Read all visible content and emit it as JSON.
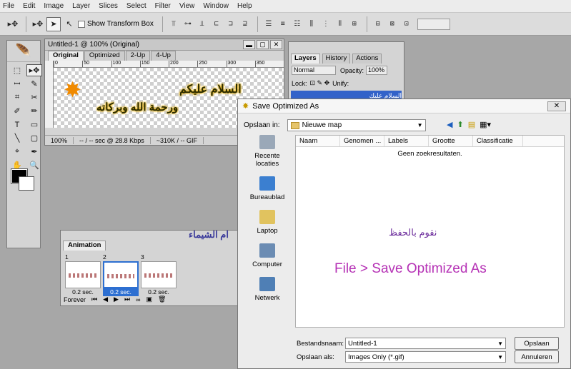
{
  "menu": [
    "File",
    "Edit",
    "Image",
    "Layer",
    "Slices",
    "Select",
    "Filter",
    "View",
    "Window",
    "Help"
  ],
  "options_bar": {
    "show_transform_box": "Show Transform Box"
  },
  "document": {
    "title": "Untitled-1 @ 100% (Original)",
    "tabs": [
      "Original",
      "Optimized",
      "2-Up",
      "4-Up"
    ],
    "ruler_ticks": [
      "0",
      "50",
      "100",
      "150",
      "200",
      "250",
      "300",
      "350",
      "400"
    ],
    "art_line1": "السلام عليكم",
    "art_line2": "ورحمة الله وبركاته",
    "status": {
      "zoom": "100%",
      "speed": "-- / -- sec @ 28.8 Kbps",
      "size": "~310K / -- GIF"
    }
  },
  "layers_panel": {
    "tabs": [
      "Layers",
      "History",
      "Actions"
    ],
    "blend": "Normal",
    "opacity_label": "Opacity:",
    "opacity": "100%",
    "lock_label": "Lock:",
    "unify_label": "Unify:",
    "layer_name": "السلام عليك"
  },
  "animation_panel": {
    "tab": "Animation",
    "frames": [
      {
        "num": "1",
        "delay": "0.2 sec."
      },
      {
        "num": "2",
        "delay": "0.2 sec."
      },
      {
        "num": "3",
        "delay": "0.2 sec."
      }
    ],
    "loop": "Forever"
  },
  "overlay_arabic1": "ام الشيماء",
  "dialog": {
    "title": "Save Optimized As",
    "look_in_label": "Opslaan in:",
    "look_in_value": "Nieuwe map",
    "places": [
      "Recente locaties",
      "Bureaublad",
      "Laptop",
      "Computer",
      "Netwerk"
    ],
    "columns": [
      "Naam",
      "Genomen ...",
      "Labels",
      "Grootte",
      "Classificatie"
    ],
    "empty_text": "Geen zoekresultaten.",
    "overlay_arabic": "نقوم بالحفظ",
    "overlay_text": "File > Save Optimized As",
    "filename_label": "Bestandsnaam:",
    "filename_value": "Untitled-1",
    "type_label": "Opslaan als:",
    "type_value": "Images Only (*.gif)",
    "save_button": "Opslaan",
    "cancel_button": "Annuleren"
  }
}
